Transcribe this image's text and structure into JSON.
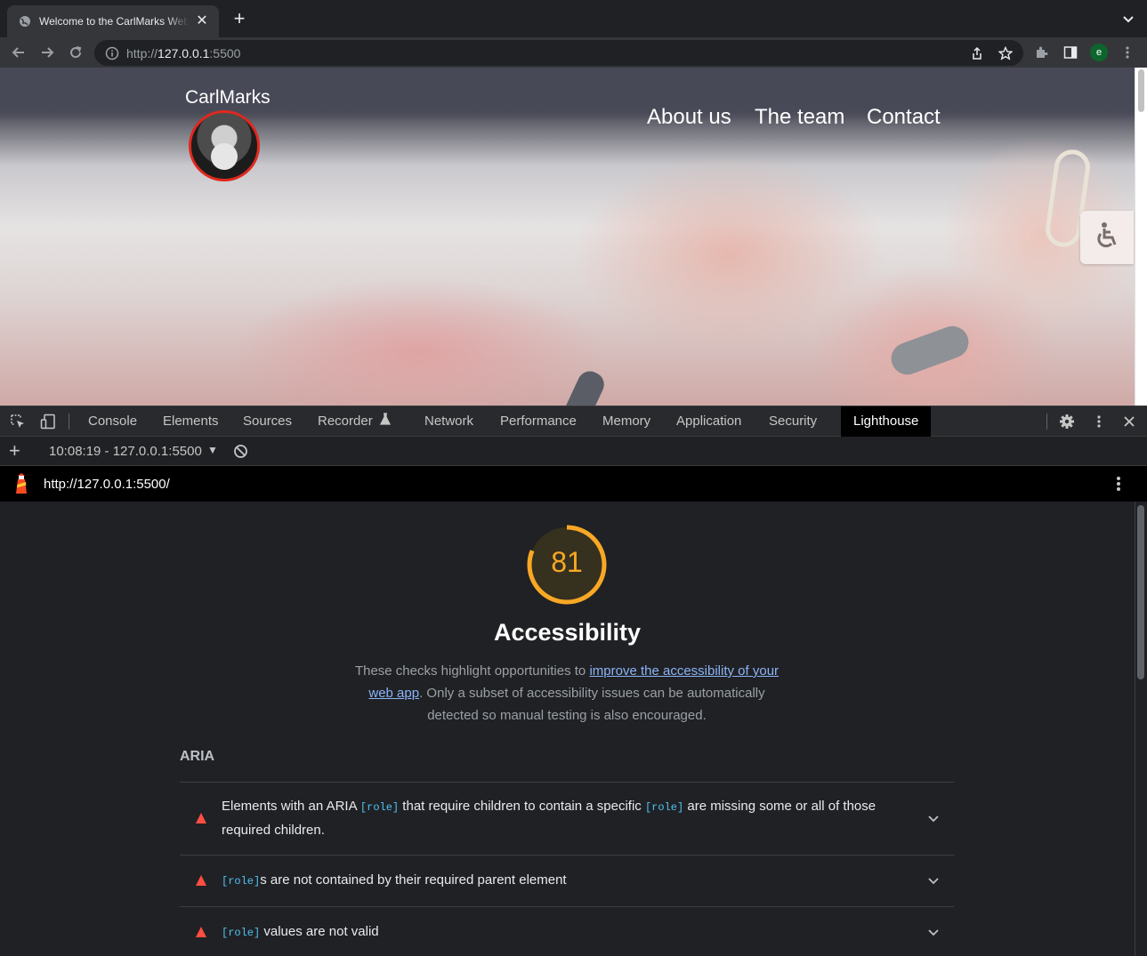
{
  "browser": {
    "tab_title": "Welcome to the CarlMarks Website",
    "url": {
      "scheme": "http://",
      "host": "127.0.0.1",
      "port": ":5500"
    },
    "profile_initial": "e"
  },
  "site": {
    "brand": "CarlMarks",
    "nav": [
      "About us",
      "The team",
      "Contact"
    ]
  },
  "devtools": {
    "tabs": [
      "Console",
      "Elements",
      "Sources",
      "Recorder",
      "Network",
      "Performance",
      "Memory",
      "Application",
      "Security",
      "Lighthouse"
    ],
    "active_tab": "Lighthouse",
    "report_selector": "10:08:19 - 127.0.0.1:5500",
    "lighthouse": {
      "url": "http://127.0.0.1:5500/",
      "score": "81",
      "score_fraction": 0.81,
      "category_title": "Accessibility",
      "description": {
        "before": "These checks highlight opportunities to ",
        "link": "improve the accessibility of your web app",
        "after": ". Only a subset of accessibility issues can be automatically detected so manual testing is also encouraged."
      },
      "group_title": "ARIA",
      "audits": [
        {
          "parts": [
            "Elements with an ARIA ",
            "[role]",
            " that require children to contain a specific ",
            "[role]",
            " are missing some or all of those required children."
          ]
        },
        {
          "parts": [
            "",
            "[role]",
            "s are not contained by their required parent element"
          ]
        },
        {
          "parts": [
            "",
            "[role]",
            " values are not valid"
          ]
        }
      ]
    }
  },
  "colors": {
    "score_average": "#f9a825",
    "fail": "#ff4e42",
    "link": "#8ab4f8",
    "code": "#4fc3f7"
  }
}
